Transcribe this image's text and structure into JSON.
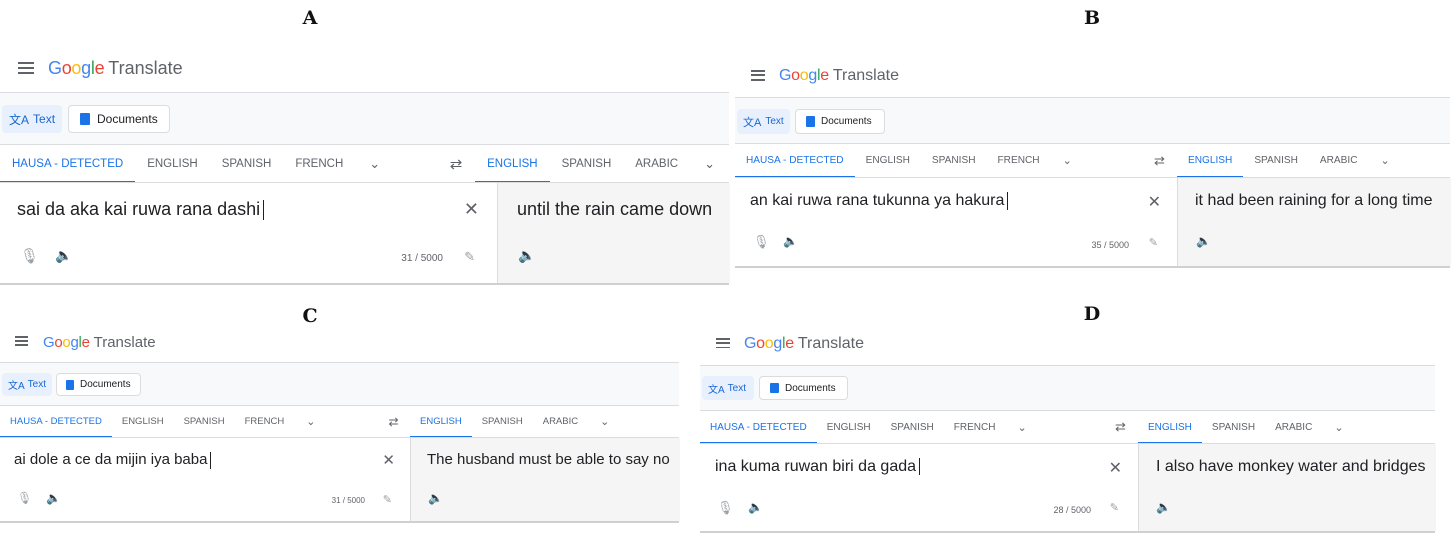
{
  "panels": [
    {
      "label": "A",
      "app_title_google": "Google",
      "app_title_translate": "Translate",
      "modes": {
        "text": "Text",
        "documents": "Documents"
      },
      "source_langs": [
        "HAUSA - DETECTED",
        "ENGLISH",
        "SPANISH",
        "FRENCH"
      ],
      "target_langs": [
        "ENGLISH",
        "SPANISH",
        "ARABIC"
      ],
      "source_text": "sai da aka kai ruwa rana dashi",
      "char_count": "31 / 5000",
      "translation": "until the rain came down"
    },
    {
      "label": "B",
      "app_title_google": "Google",
      "app_title_translate": "Translate",
      "modes": {
        "text": "Text",
        "documents": "Documents"
      },
      "source_langs": [
        "HAUSA - DETECTED",
        "ENGLISH",
        "SPANISH",
        "FRENCH"
      ],
      "target_langs": [
        "ENGLISH",
        "SPANISH",
        "ARABIC"
      ],
      "source_text": "an kai ruwa rana tukunna ya hakura",
      "char_count": "35 / 5000",
      "translation": "it had been raining for a long time"
    },
    {
      "label": "C",
      "app_title_google": "Google",
      "app_title_translate": "Translate",
      "modes": {
        "text": "Text",
        "documents": "Documents"
      },
      "source_langs": [
        "HAUSA - DETECTED",
        "ENGLISH",
        "SPANISH",
        "FRENCH"
      ],
      "target_langs": [
        "ENGLISH",
        "SPANISH",
        "ARABIC"
      ],
      "source_text": "ai dole a ce da mijin iya baba",
      "char_count": "31 / 5000",
      "translation": "The husband must be able to say no"
    },
    {
      "label": "D",
      "app_title_google": "Google",
      "app_title_translate": "Translate",
      "modes": {
        "text": "Text",
        "documents": "Documents"
      },
      "source_langs": [
        "HAUSA - DETECTED",
        "ENGLISH",
        "SPANISH",
        "FRENCH"
      ],
      "target_langs": [
        "ENGLISH",
        "SPANISH",
        "ARABIC"
      ],
      "source_text": "ina kuma ruwan biri da gada",
      "char_count": "28 / 5000",
      "translation": "I also have monkey water and bridges"
    }
  ],
  "colors": {
    "google_blue": "#4285F4",
    "google_red": "#EA4335",
    "google_yellow": "#FBBC05",
    "google_green": "#34A853",
    "accent": "#1a73e8"
  },
  "icons": [
    "menu-icon",
    "translate-icon",
    "document-icon",
    "swap-icon",
    "chevron-down-icon",
    "close-icon",
    "microphone-icon",
    "speaker-icon",
    "pencil-icon"
  ]
}
